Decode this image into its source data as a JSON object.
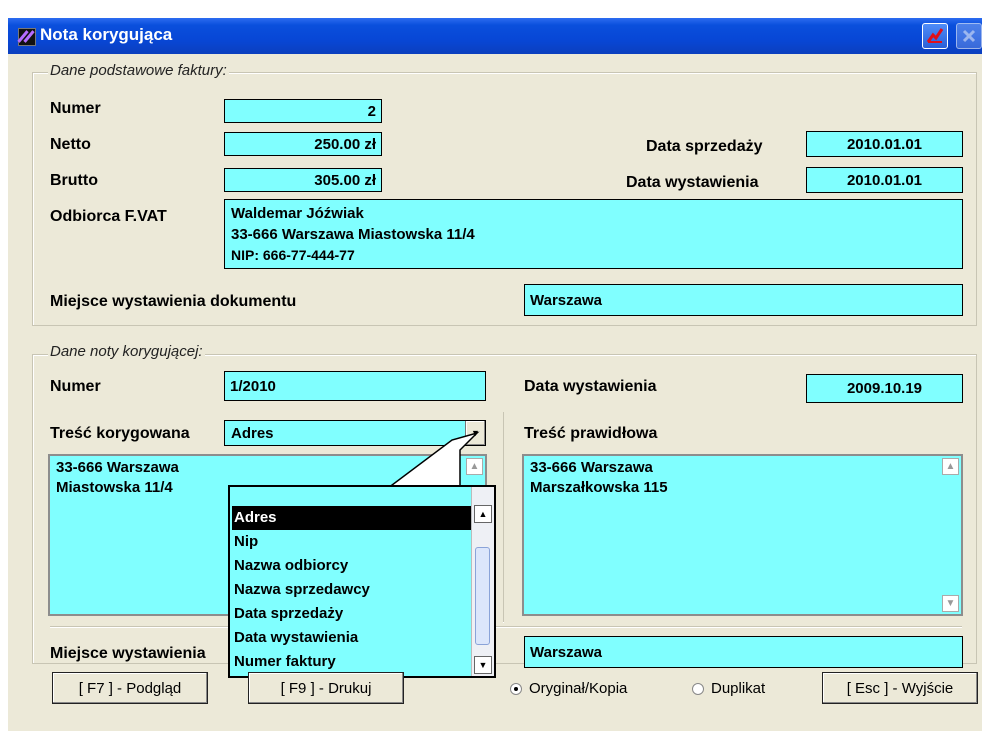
{
  "window": {
    "title": "Nota korygująca"
  },
  "basic": {
    "group_title": "Dane podstawowe faktury:",
    "numer_label": "Numer",
    "numer_value": "2",
    "netto_label": "Netto",
    "netto_value": "250.00 zł",
    "brutto_label": "Brutto",
    "brutto_value": "305.00 zł",
    "data_sprzedazy_label": "Data sprzedaży",
    "data_sprzedazy_value": "2010.01.01",
    "data_wystawienia_label": "Data wystawienia",
    "data_wystawienia_value": "2010.01.01",
    "odbiorca_label": "Odbiorca F.VAT",
    "odbiorca_lines": [
      "Waldemar Jóźwiak",
      "33-666 Warszawa  Miastowska 11/4",
      "NIP: 666-77-444-77"
    ],
    "miejsce_label": "Miejsce wystawienia dokumentu",
    "miejsce_value": "Warszawa"
  },
  "nota": {
    "group_title": "Dane noty korygującej:",
    "numer_label": "Numer",
    "numer_value": "1/2010",
    "data_wystawienia_label": "Data wystawienia",
    "data_wystawienia_value": "2009.10.19",
    "tresc_korygowana_label": "Treść korygowana",
    "tresc_korygowana_selected": "Adres",
    "tresc_korygowana_lines": [
      "33-666 Warszawa",
      "Miastowska 11/4"
    ],
    "tresc_prawidlowa_label": "Treść prawidłowa",
    "tresc_prawidlowa_lines": [
      "33-666 Warszawa",
      "Marszałkowska 115"
    ],
    "miejsce_label": "Miejsce wystawienia",
    "miejsce_value": "Warszawa",
    "dropdown_options": [
      "Adres",
      "Nip",
      "Nazwa odbiorcy",
      "Nazwa sprzedawcy",
      "Data sprzedaży",
      "Data wystawienia",
      "Numer faktury"
    ]
  },
  "footer": {
    "preview_button": "[ F7 ] - Podgląd",
    "print_button": "[ F9 ] - Drukuj",
    "radio_original": "Oryginał/Kopia",
    "radio_duplicate": "Duplikat",
    "exit_button": "[ Esc ] - Wyjście"
  },
  "colors": {
    "field_bg": "#80ffff",
    "window_bg": "#ece9d8",
    "titlebar": "#0a4fdc"
  }
}
